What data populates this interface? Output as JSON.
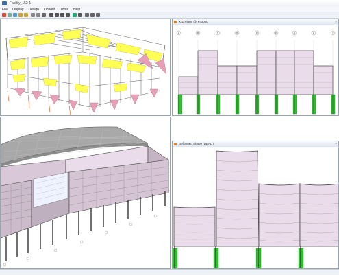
{
  "window": {
    "title": "Facility_152-1"
  },
  "menu": [
    "File",
    "Display",
    "Design",
    "Options",
    "Tools",
    "Help"
  ],
  "views": {
    "top_left": {
      "title": "",
      "icon": "3d-view-icon"
    },
    "top_right": {
      "title": "X-Z Plane @ Y=3000",
      "icon": "elevation-view-icon",
      "close": "×"
    },
    "bottom_left": {
      "title": "",
      "icon": "3d-view-icon"
    },
    "bottom_right": {
      "title": "Deformed Shape (DEAD)",
      "icon": "deformed-shape-icon",
      "close": "×"
    }
  },
  "grid_bubbles": [
    "A",
    "B",
    "C",
    "D",
    "E",
    "F",
    "G",
    "H",
    "I"
  ],
  "colors": {
    "frame": "#4a4a4a",
    "panel_fill": "#eadcea",
    "column_green": "#2ec02e",
    "moment_yellow": "#ffff55",
    "moment_pink": "#e8a0b8",
    "roof": "#a8a8a8"
  }
}
